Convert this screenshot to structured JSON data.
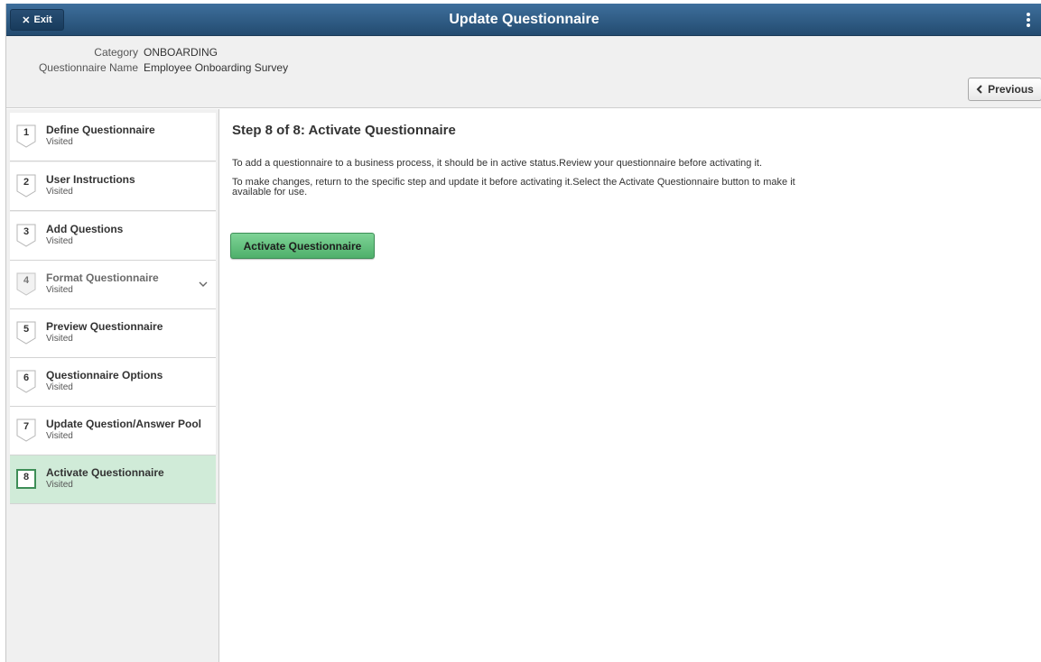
{
  "banner": {
    "exit_icon": "close-icon",
    "exit_label": "Exit",
    "title": "Update Questionnaire",
    "actions_icon": "kebab-menu-icon",
    "color": "#2f5d86"
  },
  "header": {
    "category_label": "Category",
    "category_value": "ONBOARDING",
    "name_label": "Questionnaire Name",
    "name_value": "Employee Onboarding Survey",
    "previous_label": "Previous",
    "previous_icon": "chevron-left-icon"
  },
  "steps": [
    {
      "number": "1",
      "title": "Define Questionnaire",
      "status": "Visited"
    },
    {
      "number": "2",
      "title": "User Instructions",
      "status": "Visited"
    },
    {
      "number": "3",
      "title": "Add Questions",
      "status": "Visited"
    },
    {
      "number": "4",
      "title": "Format Questionnaire",
      "status": "Visited",
      "icon": "chevron-down-icon"
    },
    {
      "number": "5",
      "title": "Preview Questionnaire",
      "status": "Visited"
    },
    {
      "number": "6",
      "title": "Questionnaire Options",
      "status": "Visited"
    },
    {
      "number": "7",
      "title": "Update Question/Answer Pool",
      "status": "Visited"
    },
    {
      "number": "8",
      "title": "Activate Questionnaire",
      "status": "Visited",
      "active": true
    }
  ],
  "main": {
    "heading": "Step 8 of 8: Activate Questionnaire",
    "para1": "To add a questionnaire to a business process, it should be in active status.Review your questionnaire before activating it.",
    "para2_line1": "To make changes, return to the specific step and update it before activating it.Select the Activate Questionnaire button to make it",
    "para2_line2": "available for use.",
    "activate_label": "Activate Questionnaire",
    "accent": "#5bbd77",
    "active_step_color": "#d0ebd8"
  }
}
